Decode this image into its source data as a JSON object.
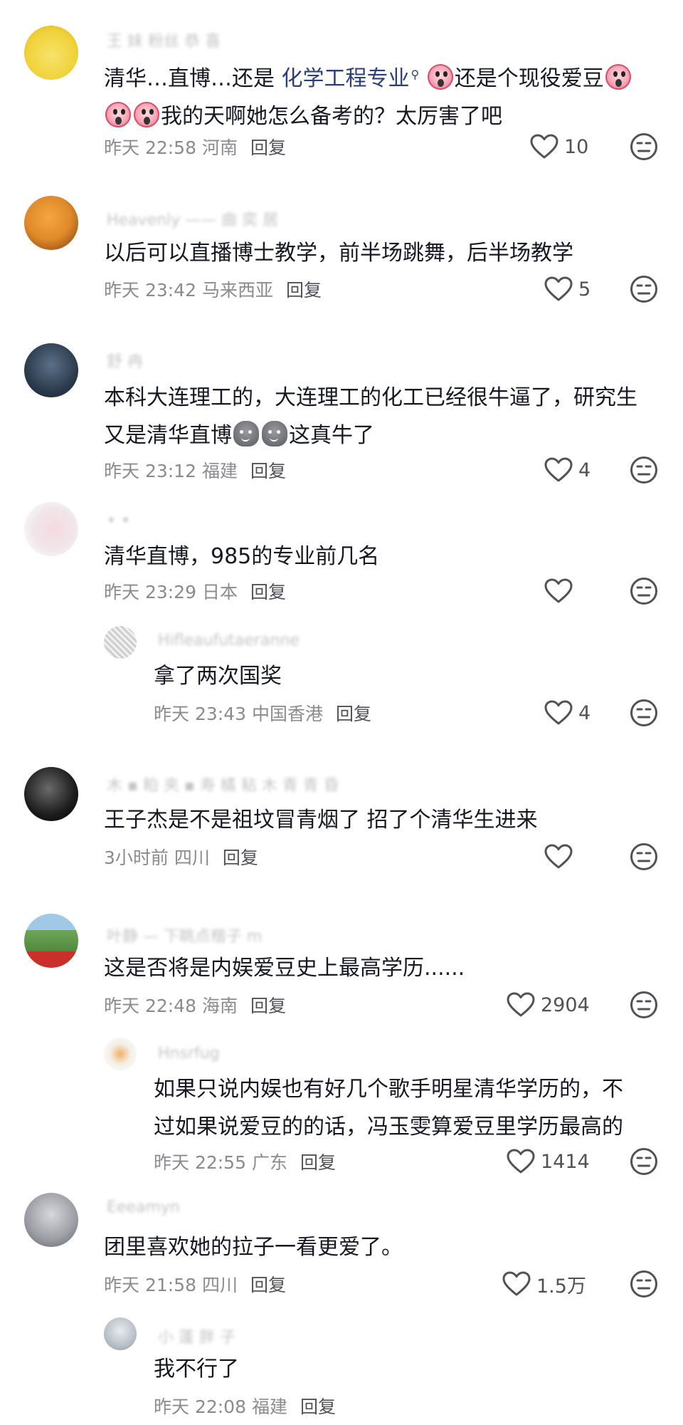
{
  "comments": [
    {
      "username": "王 妹 粉丝 恭 喜",
      "text_parts": [
        "清华…直博…还是 ",
        "化学工程专业",
        "还是个现役爱豆",
        "我的天啊她怎么备考的？太厉害了吧"
      ],
      "emojis": [
        "scream-emoji",
        "scream-emoji",
        "scream-emoji",
        "scream-emoji"
      ],
      "time": "昨天 22:58",
      "location": "河南",
      "reply": "回复",
      "likes": "10",
      "avatar_color": "#f0d23a"
    },
    {
      "username": "Heavenly —— 曲 奕 居",
      "text": "以后可以直播博士教学，前半场跳舞，后半场教学",
      "time": "昨天 23:42",
      "location": "马来西亚",
      "reply": "回复",
      "likes": "5",
      "avatar_color": "#e08a2a"
    },
    {
      "username": "舒 冉",
      "text_lines": [
        "本科大连理工的，大连理工的化工已经很牛逼了，研究生",
        "又是清华直博",
        "这真牛了"
      ],
      "emojis": [
        "poop-emoji",
        "poop-emoji"
      ],
      "time": "昨天 23:12",
      "location": "福建",
      "reply": "回复",
      "likes": "4",
      "avatar_color": "#2d3d4e"
    },
    {
      "username": "• •",
      "text": "清华直博，985的专业前几名",
      "time": "昨天 23:29",
      "location": "日本",
      "reply": "回复",
      "likes": "",
      "avatar_color": "#f0e6ea"
    },
    {
      "username": "Hifleaufutaeranne",
      "text": "拿了两次国奖",
      "time": "昨天 23:43",
      "location": "中国香港",
      "reply": "回复",
      "likes": "4",
      "avatar_color": "#d9d9d9"
    },
    {
      "username": "木 ▪ 粕 夹 ▪ 寿 橘 粘 木 青 青 昏",
      "text": "王子杰是不是祖坟冒青烟了 招了个清华生进来",
      "time": "3小时前",
      "location": "四川",
      "reply": "回复",
      "likes": "",
      "avatar_color": "#1c1c1c"
    },
    {
      "username": "叶静 — 下眺点楷子 m",
      "text": "这是否将是内娱爱豆史上最高学历......",
      "time": "昨天 22:48",
      "location": "海南",
      "reply": "回复",
      "likes": "2904",
      "avatar_color": "#6fa55a"
    },
    {
      "username": "Hnsrfug",
      "text_lines": [
        "如果只说内娱也有好几个歌手明星清华学历的，不",
        "过如果说爱豆的的话，冯玉雯算爱豆里学历最高的"
      ],
      "time": "昨天 22:55",
      "location": "广东",
      "reply": "回复",
      "likes": "1414",
      "avatar_color": "#f3efe6"
    },
    {
      "username": "Eeeamyn",
      "text": "团里喜欢她的拉子一看更爱了。",
      "time": "昨天 21:58",
      "location": "四川",
      "reply": "回复",
      "likes": "1.5万",
      "avatar_color": "#9a9ca3"
    },
    {
      "username": "小 蓬 胖 子",
      "text": "我不行了",
      "time": "昨天 22:08",
      "location": "福建",
      "reply": "回复",
      "likes": "",
      "avatar_color": "#b8c0c8"
    }
  ],
  "icons": {
    "like": "heart-outline-icon",
    "dislike": "neutral-face-icon",
    "search": "search-icon"
  },
  "colors": {
    "text": "#161823",
    "meta": "#8a8b91",
    "link": "#2a3f7a",
    "username": "#c4c4c8"
  }
}
